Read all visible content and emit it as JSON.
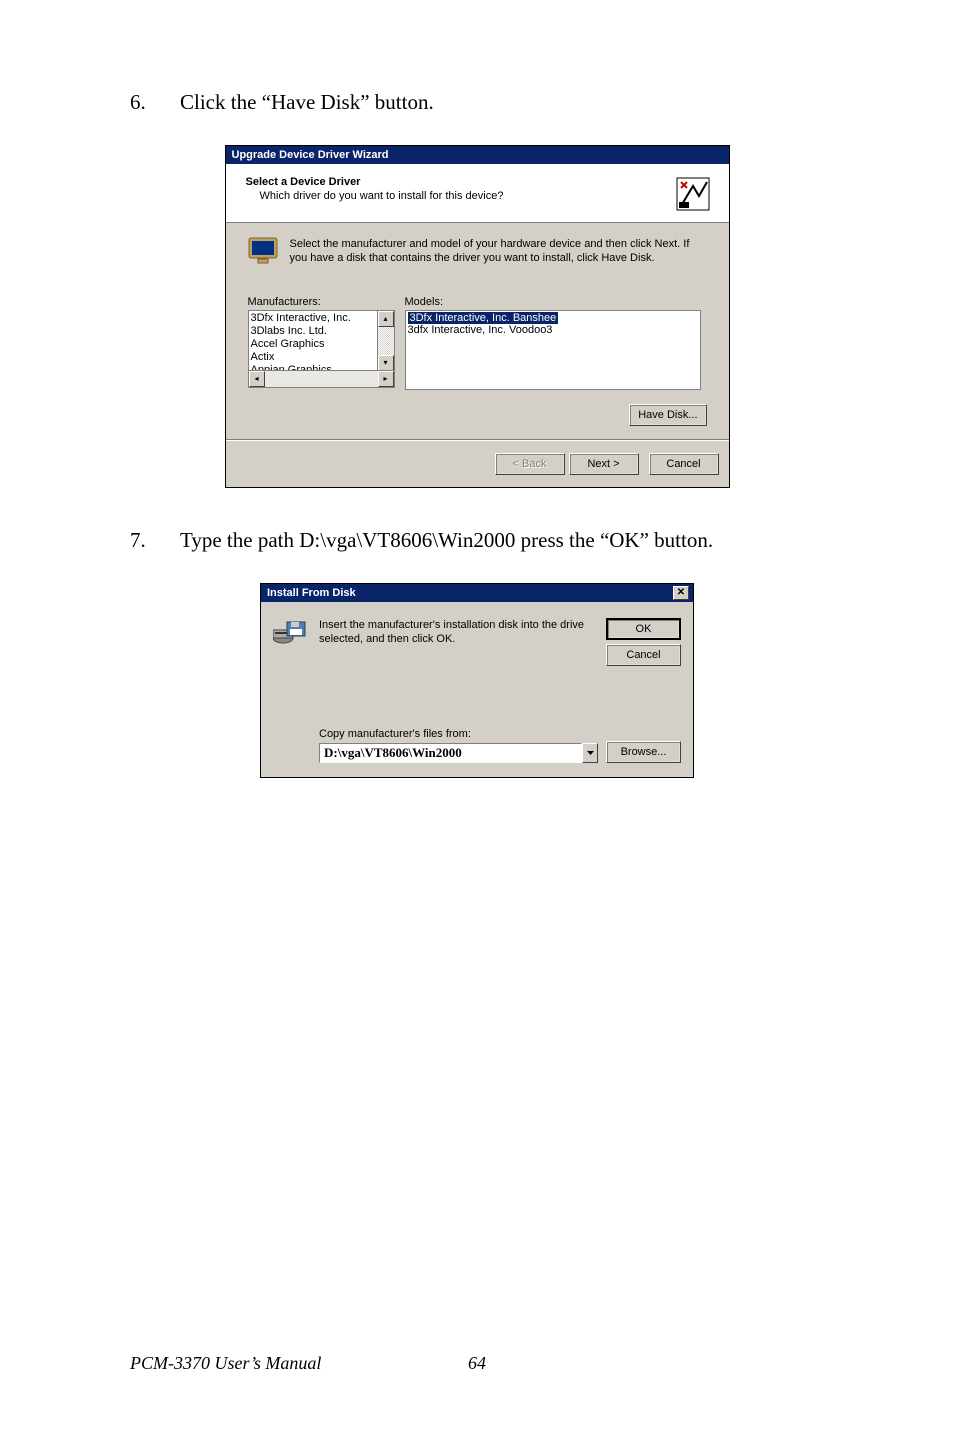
{
  "instructions": {
    "step6": {
      "num": "6.",
      "text": "Click the “Have Disk” button."
    },
    "step7": {
      "num": "7.",
      "text": "Type the path D:\\vga\\VT8606\\Win2000  press the “OK” button."
    }
  },
  "wizard": {
    "title": "Upgrade Device Driver Wizard",
    "header_title": "Select a Device Driver",
    "header_sub": "Which driver do you want to install for this device?",
    "info_text": "Select the manufacturer and model of your hardware device and then click Next. If you have a disk that contains the driver you want to install, click Have Disk.",
    "manufacturers_label": "Manufacturers:",
    "models_label": "Models:",
    "manufacturers": [
      "3Dfx Interactive, Inc.",
      "3Dlabs Inc. Ltd.",
      "Accel Graphics",
      "Actix",
      "Appian Graphics"
    ],
    "models": [
      "3Dfx Interactive, Inc. Banshee",
      "3dfx Interactive, Inc. Voodoo3"
    ],
    "have_disk": "Have Disk...",
    "back": "< Back",
    "next": "Next >",
    "cancel": "Cancel"
  },
  "ifd": {
    "title": "Install From Disk",
    "text": "Insert the manufacturer's installation disk into the drive selected, and then click OK.",
    "ok": "OK",
    "cancel": "Cancel",
    "copy_label": "Copy manufacturer's files from:",
    "path_value": "D:\\vga\\VT8606\\Win2000",
    "browse": "Browse..."
  },
  "footer": {
    "manual": "PCM-3370 User’s Manual",
    "page": "64"
  }
}
